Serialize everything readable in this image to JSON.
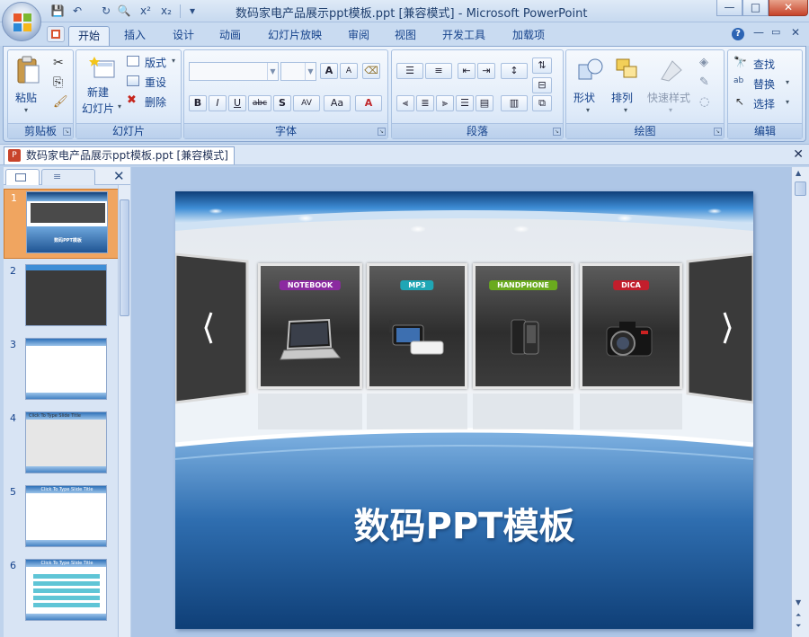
{
  "window": {
    "title": "数码家电产品展示ppt模板.ppt [兼容模式] - Microsoft PowerPoint",
    "minimize": "—",
    "maximize": "□",
    "close": "✕"
  },
  "quick_access": {
    "save": "💾",
    "undo": "↶",
    "redo": "↻",
    "print_preview": "🔍",
    "superscript": "x²",
    "subscript": "x₂",
    "customize": "▾"
  },
  "ribbon": {
    "tabs": [
      "开始",
      "插入",
      "设计",
      "动画",
      "幻灯片放映",
      "审阅",
      "视图",
      "开发工具",
      "加载项"
    ],
    "help": "?",
    "groups": {
      "clipboard": {
        "label": "剪贴板",
        "paste": "粘贴",
        "cut": "✂",
        "copy": "⎘",
        "format_painter": "🖌"
      },
      "slides": {
        "label": "幻灯片",
        "new_slide": "新建\n幻灯片",
        "new_slide_line1": "新建",
        "new_slide_line2": "幻灯片",
        "layout": "版式",
        "reset": "重设",
        "delete": "删除"
      },
      "font": {
        "label": "字体",
        "bold": "B",
        "italic": "I",
        "underline": "U",
        "strike": "abc",
        "shadow": "S",
        "spacing": "AV",
        "case": "Aa",
        "color": "A",
        "grow": "A",
        "shrink": "A"
      },
      "paragraph": {
        "label": "段落"
      },
      "drawing": {
        "label": "绘图",
        "shapes": "形状",
        "arrange": "排列",
        "quick_styles": "快速样式"
      },
      "editing": {
        "label": "编辑",
        "find": "查找",
        "replace": "替换",
        "select": "选择"
      }
    }
  },
  "document_tab": {
    "name": "数码家电产品展示ppt模板.ppt [兼容模式]",
    "close": "✕"
  },
  "slides_pane": {
    "close": "✕",
    "thumbnails": [
      {
        "number": "1",
        "caption": "数码PPT模板",
        "selected": true
      },
      {
        "number": "2",
        "caption": "",
        "selected": false
      },
      {
        "number": "3",
        "caption": "",
        "selected": false
      },
      {
        "number": "4",
        "caption": "Click To Type Slide Title",
        "selected": false
      },
      {
        "number": "5",
        "caption": "Click To Type Slide Title",
        "selected": false
      },
      {
        "number": "6",
        "caption": "Click To Type Slide Title",
        "selected": false
      }
    ]
  },
  "slide": {
    "title": "数码PPT模板",
    "products": [
      {
        "tag": "NOTEBOOK",
        "tag_color": "#8b2aa0"
      },
      {
        "tag": "MP3",
        "tag_color": "#1fa6b5"
      },
      {
        "tag": "HANDPHONE",
        "tag_color": "#6aaa1e"
      },
      {
        "tag": "DICA",
        "tag_color": "#c31e2c"
      }
    ],
    "nav_left": "◀",
    "nav_right": "▶"
  },
  "colors": {
    "ribbon_accent": "#15428b",
    "slide_blue": "#4a8ac8"
  }
}
